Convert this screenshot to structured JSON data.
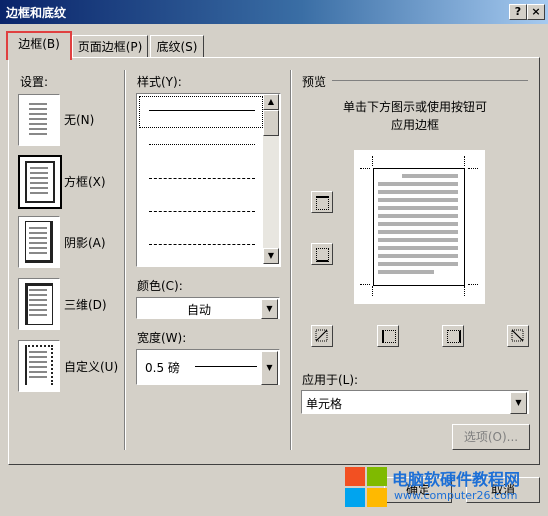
{
  "window": {
    "title": "边框和底纹",
    "help_glyph": "?",
    "close_glyph": "×"
  },
  "tabs": [
    {
      "label": "边框(B)"
    },
    {
      "label": "页面边框(P)"
    },
    {
      "label": "底纹(S)"
    }
  ],
  "settings": {
    "label": "设置:",
    "items": [
      {
        "label": "无(N)"
      },
      {
        "label": "方框(X)"
      },
      {
        "label": "阴影(A)"
      },
      {
        "label": "三维(D)"
      },
      {
        "label": "自定义(U)"
      }
    ],
    "selected_index": 1
  },
  "style": {
    "label": "样式(Y):"
  },
  "color": {
    "label": "颜色(C):",
    "value": "自动"
  },
  "width": {
    "label": "宽度(W):",
    "value": "0.5 磅"
  },
  "preview": {
    "label": "预览",
    "instruction_line1": "单击下方图示或使用按钮可",
    "instruction_line2": "应用边框"
  },
  "apply_to": {
    "label": "应用于(L):",
    "value": "单元格"
  },
  "options_button": "选项(O)...",
  "ok_button": "确定",
  "cancel_button": "取消",
  "watermark": {
    "site_name": "电脑软硬件教程网",
    "url": "www.computer26.com"
  }
}
